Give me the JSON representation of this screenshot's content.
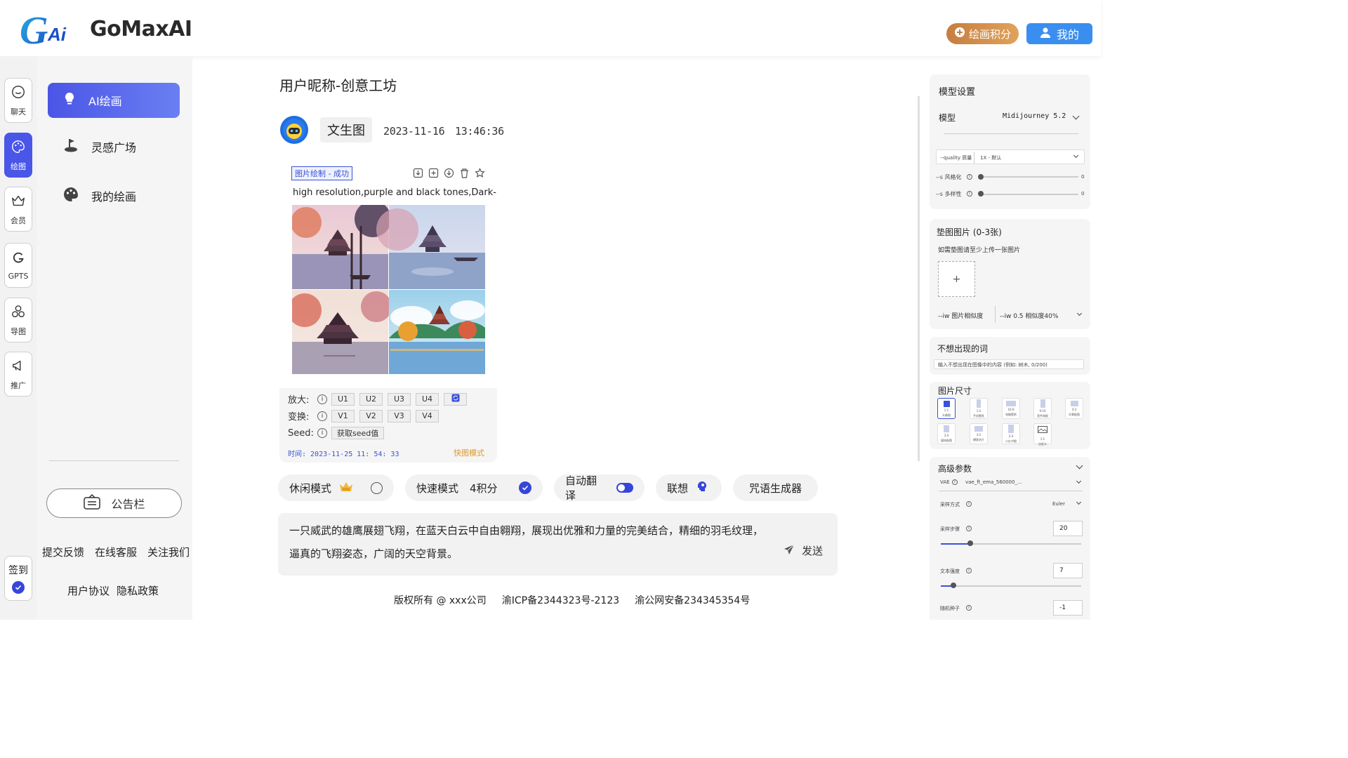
{
  "brand": {
    "name": "GoMaxAI",
    "logo_letters": "GAi"
  },
  "header": {
    "points_label": "绘画积分",
    "mine_label": "我的"
  },
  "rail": {
    "items": [
      {
        "label": "聊天",
        "icon": "chat-icon"
      },
      {
        "label": "绘图",
        "icon": "palette-icon",
        "active": true
      },
      {
        "label": "会员",
        "icon": "crown-icon"
      },
      {
        "label": "GPTS",
        "icon": "g-icon"
      },
      {
        "label": "导图",
        "icon": "mindmap-icon"
      },
      {
        "label": "推广",
        "icon": "megaphone-icon"
      }
    ],
    "sign_label": "签到"
  },
  "nav": {
    "items": [
      {
        "label": "AI绘画",
        "icon": "bulb-icon",
        "active": true
      },
      {
        "label": "灵感广场",
        "icon": "golf-icon"
      },
      {
        "label": "我的绘画",
        "icon": "palette-icon"
      }
    ],
    "notice_label": "公告栏",
    "links_row1": [
      "提交反馈",
      "在线客服",
      "关注我们"
    ],
    "links_row2": [
      "用户协议",
      "隐私政策"
    ]
  },
  "main": {
    "title": "用户昵称-创意工坊",
    "task_type": "文生图",
    "timestamp": "2023-11-16　13:46:36",
    "card": {
      "status": "图片绘制 - 成功",
      "prompt": "high resolution,purple and black tones,Dark-...",
      "upscale_label": "放大:",
      "upscale_buttons": [
        "U1",
        "U2",
        "U3",
        "U4"
      ],
      "variation_label": "变换:",
      "variation_buttons": [
        "V1",
        "V2",
        "V3",
        "V4"
      ],
      "seed_label": "Seed:",
      "seed_button": "获取seed值",
      "time_text": "时间: 2023-11-25 11: 54: 33",
      "mode_tag": "快图模式"
    },
    "modes": {
      "idle_label": "休闲模式",
      "fast_label": "快速模式",
      "fast_cost": "4积分",
      "translate_label": "自动翻译",
      "associate_label": "联想",
      "spell_label": "咒语生成器"
    },
    "prompt_text": "一只威武的雄鹰展翅飞翔，在蓝天白云中自由翱翔，展现出优雅和力量的完美结合，精细的羽毛纹理，逼真的飞翔姿态，广阔的天空背景。",
    "send_label": "发送",
    "copyright": [
      "版权所有 @ xxx公司",
      "渝ICP备2344323号-2123",
      "渝公网安备234345354号"
    ]
  },
  "settings": {
    "model_section": "模型设置",
    "model_label": "模型",
    "model_value": "Midijourney 5.2",
    "quality_label": "--quality 质量",
    "quality_value": "1X - 默认",
    "stylize_label": "--s 风格化",
    "stylize_value": "0",
    "chaos_label": "--s 多样性",
    "chaos_value": "0",
    "ref_title": "垫图图片 (0-3张)",
    "ref_hint": "如需垫图请至少上传一张图片",
    "iw_label": "--iw 图片相似度",
    "iw_value": "--iw 0.5 相似度40%",
    "neg_title": "不想出现的词",
    "neg_placeholder": "输入不想出现在图像中的内容 (例如: 树木, 0/200)",
    "size_title": "图片尺寸",
    "sizes": [
      {
        "ratio": "1:1",
        "name": "头像图"
      },
      {
        "ratio": "1:2",
        "name": "手机壁纸"
      },
      {
        "ratio": "16:9",
        "name": "电脑壁纸"
      },
      {
        "ratio": "9:16",
        "name": "宣传海报"
      },
      {
        "ratio": "4:3",
        "name": "文章配图"
      },
      {
        "ratio": "3:4",
        "name": "媒体配图"
      },
      {
        "ratio": "3:2",
        "name": "横版名片"
      },
      {
        "ratio": "2:3",
        "name": "小红书图"
      },
      {
        "ratio": "1:1",
        "name": "自定义"
      }
    ],
    "advanced_title": "高级参数",
    "vae_label": "VAE",
    "vae_value": "vae_ft_ema_560000_...",
    "sampler_label": "采样方式",
    "sampler_value": "Euler",
    "steps_label": "采样步骤",
    "steps_value": "20",
    "steps_fraction": 0.21,
    "cfg_label": "文本强度",
    "cfg_value": "7",
    "cfg_fraction": 0.09,
    "seed_label": "随机种子",
    "seed_value": "-1"
  },
  "colors": {
    "accent": "#4b55e6",
    "link": "#3a52d8",
    "points": "#d58e48",
    "mine": "#3a8ef0"
  }
}
